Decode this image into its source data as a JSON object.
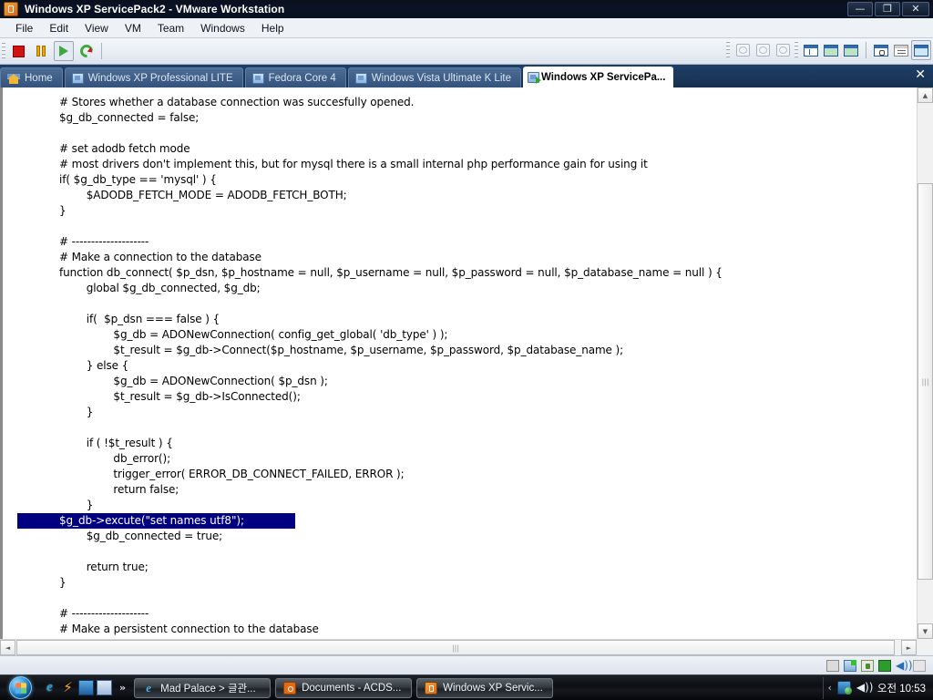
{
  "window": {
    "title": "Windows XP ServicePack2 - VMware Workstation",
    "icon": "vmware-icon",
    "controls": {
      "minimize": "—",
      "restore": "❐",
      "close": "✕"
    }
  },
  "menubar": {
    "items": [
      {
        "label": "File"
      },
      {
        "label": "Edit"
      },
      {
        "label": "View"
      },
      {
        "label": "VM"
      },
      {
        "label": "Team"
      },
      {
        "label": "Windows"
      },
      {
        "label": "Help"
      }
    ]
  },
  "toolbar": {
    "buttons": [
      {
        "name": "power-off-button",
        "icon": "stop-icon"
      },
      {
        "name": "suspend-button",
        "icon": "pause-icon"
      },
      {
        "name": "power-on-button",
        "icon": "play-icon"
      },
      {
        "name": "reset-button",
        "icon": "reset-icon"
      }
    ],
    "right_buttons": [
      {
        "name": "snapshot-button",
        "icon": "snapshot-icon"
      },
      {
        "name": "revert-snapshot-button",
        "icon": "revert-snapshot-icon"
      },
      {
        "name": "manage-snapshots-button",
        "icon": "manage-snapshots-icon"
      },
      {
        "name": "show-sidebar-button",
        "icon": "sidebar-panel-icon"
      },
      {
        "name": "quick-switch-button",
        "icon": "quick-switch-icon"
      },
      {
        "name": "fullscreen-button",
        "icon": "fullscreen-icon"
      },
      {
        "name": "vm-settings-button",
        "icon": "wrench-window-icon"
      },
      {
        "name": "vm-summary-button",
        "icon": "summary-card-icon"
      },
      {
        "name": "vm-console-button",
        "icon": "console-window-icon"
      }
    ]
  },
  "tabs": {
    "items": [
      {
        "label": "Home",
        "icon": "home-icon",
        "active": false
      },
      {
        "label": "Windows XP Professional LITE",
        "icon": "vm-tab-icon",
        "active": false
      },
      {
        "label": "Fedora Core 4",
        "icon": "vm-tab-icon",
        "active": false
      },
      {
        "label": "Windows Vista Ultimate K Lite",
        "icon": "vm-tab-icon",
        "active": false
      },
      {
        "label": "Windows XP ServicePa...",
        "icon": "vm-tab-icon-running",
        "active": true
      }
    ],
    "close_label": "✕"
  },
  "editor": {
    "lines": [
      {
        "text": "# Stores whether a database connection was succesfully opened.",
        "highlight": false
      },
      {
        "text": "$g_db_connected = false;",
        "highlight": false
      },
      {
        "text": "",
        "highlight": false
      },
      {
        "text": "# set adodb fetch mode",
        "highlight": false
      },
      {
        "text": "# most drivers don't implement this, but for mysql there is a small internal php performance gain for using it",
        "highlight": false
      },
      {
        "text": "if( $g_db_type == 'mysql' ) {",
        "highlight": false
      },
      {
        "text": "        $ADODB_FETCH_MODE = ADODB_FETCH_BOTH;",
        "highlight": false
      },
      {
        "text": "}",
        "highlight": false
      },
      {
        "text": "",
        "highlight": false
      },
      {
        "text": "# --------------------",
        "highlight": false
      },
      {
        "text": "# Make a connection to the database",
        "highlight": false
      },
      {
        "text": "function db_connect( $p_dsn, $p_hostname = null, $p_username = null, $p_password = null, $p_database_name = null ) {",
        "highlight": false
      },
      {
        "text": "        global $g_db_connected, $g_db;",
        "highlight": false
      },
      {
        "text": "",
        "highlight": false
      },
      {
        "text": "        if(  $p_dsn === false ) {",
        "highlight": false
      },
      {
        "text": "                $g_db = ADONewConnection( config_get_global( 'db_type' ) );",
        "highlight": false
      },
      {
        "text": "                $t_result = $g_db->Connect($p_hostname, $p_username, $p_password, $p_database_name );",
        "highlight": false
      },
      {
        "text": "        } else {",
        "highlight": false
      },
      {
        "text": "                $g_db = ADONewConnection( $p_dsn );",
        "highlight": false
      },
      {
        "text": "                $t_result = $g_db->IsConnected();",
        "highlight": false
      },
      {
        "text": "        }",
        "highlight": false
      },
      {
        "text": "",
        "highlight": false
      },
      {
        "text": "        if ( !$t_result ) {",
        "highlight": false
      },
      {
        "text": "                db_error();",
        "highlight": false
      },
      {
        "text": "                trigger_error( ERROR_DB_CONNECT_FAILED, ERROR );",
        "highlight": false
      },
      {
        "text": "                return false;",
        "highlight": false
      },
      {
        "text": "        }",
        "highlight": false
      },
      {
        "text": "        $g_db->excute(\"set names utf8\");",
        "highlight": true
      },
      {
        "text": "        $g_db_connected = true;",
        "highlight": false
      },
      {
        "text": "",
        "highlight": false
      },
      {
        "text": "        return true;",
        "highlight": false
      },
      {
        "text": "}",
        "highlight": false
      },
      {
        "text": "",
        "highlight": false
      },
      {
        "text": "# --------------------",
        "highlight": false
      },
      {
        "text": "# Make a persistent connection to the database",
        "highlight": false
      }
    ],
    "highlight_color": "#000080",
    "highlight_text_color": "#ffffff",
    "background_color": "#ffffff",
    "text_color": "#000000"
  },
  "scrollbars": {
    "v_up": "▲",
    "v_down": "▼",
    "h_left": "◄",
    "h_right": "►",
    "grip": "|||"
  },
  "vm_status_icons": [
    {
      "name": "floppy-status-icon"
    },
    {
      "name": "harddisk-status-icon"
    },
    {
      "name": "cdrom-status-icon"
    },
    {
      "name": "network-status-icon"
    },
    {
      "name": "sound-status-icon",
      "glyph": "◀))"
    },
    {
      "name": "usb-status-icon"
    }
  ],
  "taskbar": {
    "start_label": "",
    "quick_launch": [
      {
        "name": "ie-quicklaunch-icon",
        "glyph": "e"
      },
      {
        "name": "flash-quicklaunch-icon",
        "glyph": "⚡"
      },
      {
        "name": "show-desktop-icon"
      },
      {
        "name": "switch-windows-icon"
      }
    ],
    "overflow_glyph": "»",
    "items": [
      {
        "label": "Mad Palace > 글관...",
        "icon": "ie"
      },
      {
        "label": "Documents - ACDS...",
        "icon": "acdsee"
      },
      {
        "label": "Windows XP Servic...",
        "icon": "vmware"
      }
    ],
    "tray": {
      "expand_glyph": "‹",
      "icons": [
        {
          "name": "network-tray-icon"
        },
        {
          "name": "volume-tray-icon",
          "glyph": "◀))"
        }
      ],
      "clock": "오전 10:53"
    }
  }
}
